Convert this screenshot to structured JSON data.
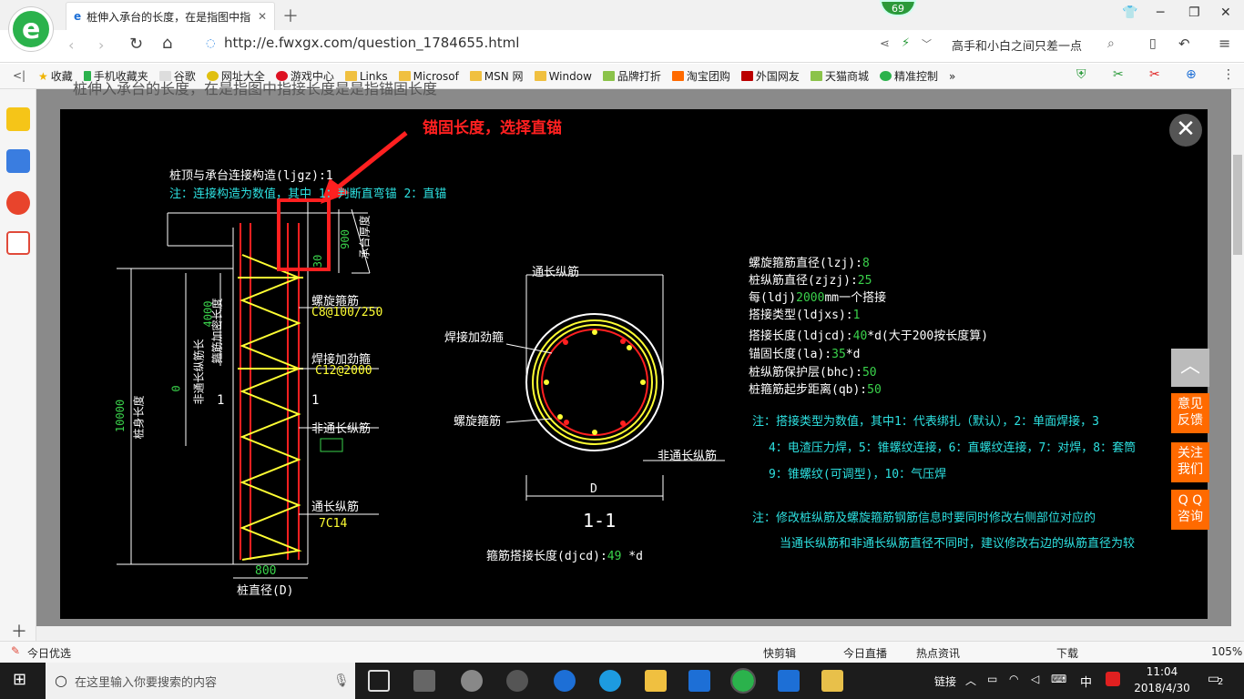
{
  "browser": {
    "tab_title": "桩伸入承台的长度，在是指图中指",
    "badge_count": "69",
    "url": "http://e.fwxgx.com/question_1784655.html",
    "search_text": "高手和小白之间只差一点",
    "bookmarks": [
      "收藏",
      "手机收藏夹",
      "谷歌",
      "网址大全",
      "游戏中心",
      "Links",
      "Microsof",
      "MSN 网",
      "Window",
      "品牌打折",
      "淘宝团购",
      "外国网友",
      "天猫商城",
      "精准控制"
    ],
    "page_heading": "桩伸入承台的长度，在是指图中指接长度是是指锚固长度"
  },
  "drawing": {
    "callout": "锚固长度，选择直锚",
    "lines_left": [
      {
        "label": "桩顶与承台连接构造(ljgz):1"
      },
      {
        "label": "注：连接构造为数值，其中 1：判断直弯锚     2：直锚"
      }
    ],
    "dim_labels": {
      "height_900": "900",
      "cap_thickness": "承台厚度",
      "anchor_30": "30",
      "strength_length": "箍筋加密长度",
      "v4000": "4000",
      "nonfull": "非通长纵筋长",
      "v0": "0",
      "pile_length": "桩身长度",
      "v10000": "10000",
      "diameter_label": "桩直径(D)",
      "v800": "800",
      "section_mark_a": "1",
      "section_mark_b": "1"
    },
    "side_labels": [
      {
        "text": "螺旋箍筋"
      },
      {
        "text": "C8@100/250"
      },
      {
        "text": "焊接加劲箍"
      },
      {
        "text": "C12@2000"
      },
      {
        "text": "非通长纵筋"
      },
      {
        "text": "通长纵筋"
      },
      {
        "text": "7C14"
      }
    ],
    "section": {
      "top_label": "通长纵筋",
      "weld_label": "焊接加劲箍",
      "spiral_label": "螺旋箍筋",
      "nonfull_label": "非通长纵筋",
      "d_label": "D",
      "section_name": "1-1",
      "lap_text": "箍筋搭接长度(djcd):",
      "lap_value": "49",
      "lap_unit": "*d"
    },
    "params": [
      {
        "label": "螺旋箍筋直径(lzj):",
        "value": "8",
        "unit": ""
      },
      {
        "label": "桩纵筋直径(zjzj):",
        "value": "25",
        "unit": ""
      },
      {
        "label": "每(ldj)",
        "value": "2000",
        "unit": "mm一个搭接"
      },
      {
        "label": "搭接类型(ldjxs):",
        "value": "1",
        "unit": ""
      },
      {
        "label": "搭接长度(ldjcd):",
        "value": "40",
        "unit": "*d(大于200按长度算)"
      },
      {
        "label": "锚固长度(la):",
        "value": "35",
        "unit": "*d"
      },
      {
        "label": "桩纵筋保护层(bhc):",
        "value": "50",
        "unit": ""
      },
      {
        "label": "桩箍筋起步距离(qb):",
        "value": "50",
        "unit": ""
      }
    ],
    "notes": [
      "注：搭接类型为数值，其中1：代表绑扎（默认），2：单面焊接，3",
      "4：电渣压力焊，5：锥螺纹连接，6：直螺纹连接，7：对焊，8：套筒",
      "9：锥螺纹(可调型)，10：气压焊",
      "注：修改桩纵筋及螺旋箍筋钢筋信息时要同时修改右侧部位对应的",
      "当通长纵筋和非通长纵筋直径不同时，建议修改右边的纵筋直径为较"
    ]
  },
  "floating": {
    "feedback": [
      "意见",
      "反馈"
    ],
    "follow": [
      "关注",
      "我们"
    ],
    "qq": [
      "Q Q",
      "咨询"
    ]
  },
  "statusbar": {
    "left": "今日优选",
    "items": [
      "快剪辑",
      "今日直播",
      "热点资讯",
      "下载"
    ],
    "zoom": "105%"
  },
  "taskbar": {
    "search_placeholder": "在这里输入你要搜索的内容",
    "tray_link": "链接",
    "ime": "中",
    "time": "11:04",
    "date": "2018/4/30",
    "notify_count": "2"
  }
}
